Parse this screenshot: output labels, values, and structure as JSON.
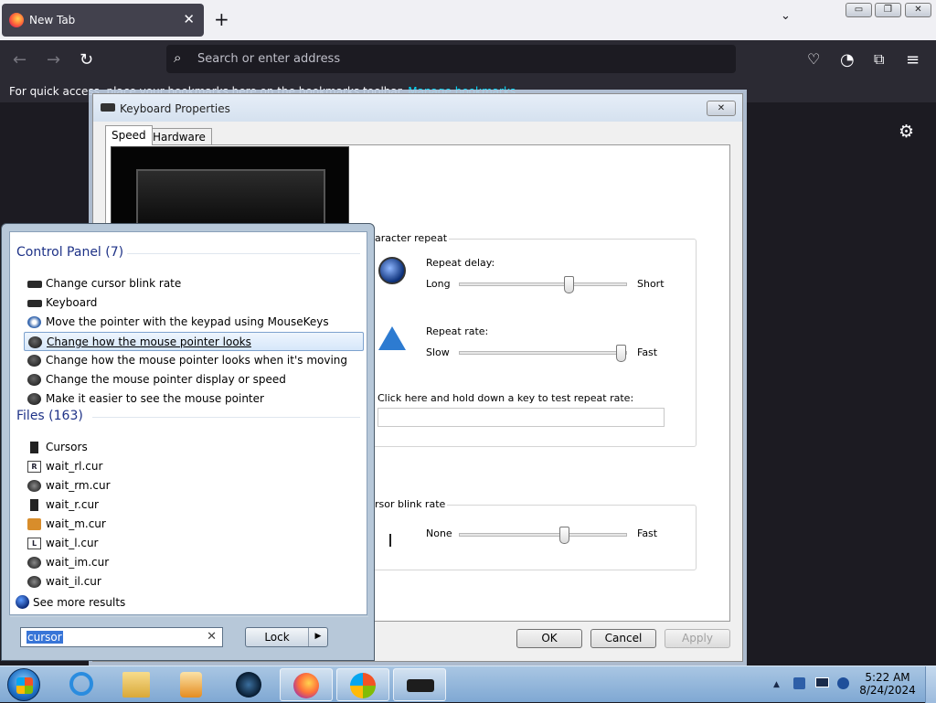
{
  "browser": {
    "tab_title": "New Tab",
    "tab_close": "✕",
    "new_tab": "+",
    "list_tabs": "⌄",
    "address_placeholder": "Search or enter address",
    "bookmarks_text": "For quick access, place your bookmarks here on the bookmarks toolbar.",
    "bookmarks_link": "Manage bookmarks",
    "window_controls": {
      "minimize": "▭",
      "restore": "❐",
      "close": "✕"
    }
  },
  "keyboard_dialog": {
    "title": "Keyboard Properties",
    "tabs": [
      "Speed",
      "Hardware"
    ],
    "character_repeat_label": "aracter repeat",
    "repeat_delay_label": "Repeat delay:",
    "repeat_delay_min": "Long",
    "repeat_delay_max": "Short",
    "repeat_delay_level": 0.66,
    "repeat_rate_label": "Repeat rate:",
    "repeat_rate_min": "Slow",
    "repeat_rate_max": "Fast",
    "repeat_rate_level": 0.97,
    "test_label": "Click here and hold down a key to test repeat rate:",
    "cursor_blink_label": "rsor blink rate",
    "blink_min": "None",
    "blink_max": "Fast",
    "blink_level": 0.63,
    "ok": "OK",
    "cancel": "Cancel",
    "apply": "Apply"
  },
  "start_menu": {
    "control_panel_header": "Control Panel (7)",
    "control_panel_items": [
      "Change cursor blink rate",
      "Keyboard",
      "Move the pointer with the keypad using MouseKeys",
      "Change how the mouse pointer looks",
      "Change how the mouse pointer looks when it's moving",
      "Change the mouse pointer display or speed",
      "Make it easier to see the mouse pointer"
    ],
    "files_header": "Files (163)",
    "file_items": [
      "Cursors",
      "wait_rl.cur",
      "wait_rm.cur",
      "wait_r.cur",
      "wait_m.cur",
      "wait_l.cur",
      "wait_im.cur",
      "wait_il.cur"
    ],
    "see_more": "See more results",
    "search_value": "cursor",
    "search_clear": "✕",
    "lock_label": "Lock",
    "lock_arrow": "▶"
  },
  "taskbar": {
    "time": "5:22 AM",
    "date": "8/24/2024",
    "tray_arrow": "▲"
  },
  "colors": {
    "browser_dark": "#2b2a33",
    "link": "#00ddff",
    "selection": "#3875d7",
    "taskbar": "#a9c6e3"
  }
}
